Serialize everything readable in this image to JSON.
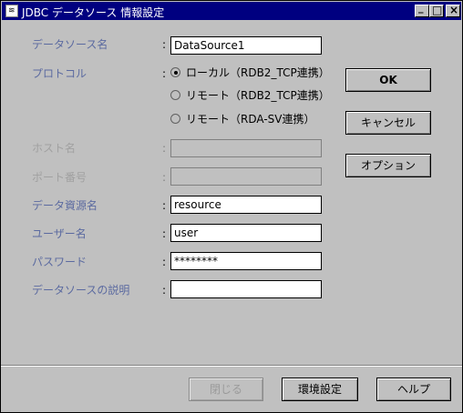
{
  "window": {
    "title": "JDBC データソース 情報設定",
    "icon_text": "≋",
    "minimize_glyph": "_",
    "maximize_glyph": "□",
    "close_glyph": "×"
  },
  "form": {
    "datasource_name": {
      "label": "データソース名",
      "value": "DataSource1"
    },
    "protocol": {
      "label": "プロトコル",
      "options": [
        {
          "label": "ローカル（RDB2_TCP連携）",
          "selected": true
        },
        {
          "label": "リモート（RDB2_TCP連携）",
          "selected": false
        },
        {
          "label": "リモート（RDA-SV連携）",
          "selected": false
        }
      ]
    },
    "host_name": {
      "label": "ホスト名",
      "value": ""
    },
    "port_number": {
      "label": "ポート番号",
      "value": ""
    },
    "data_resource_name": {
      "label": "データ資源名",
      "value": "resource"
    },
    "user_name": {
      "label": "ユーザー名",
      "value": "user"
    },
    "password": {
      "label": "パスワード",
      "value": "********"
    },
    "description": {
      "label": "データソースの説明",
      "value": ""
    },
    "colon": ":"
  },
  "side_buttons": {
    "ok": "OK",
    "cancel": "キャンセル",
    "options": "オプション"
  },
  "footer_buttons": {
    "close": "閉じる",
    "environment": "環境設定",
    "help": "ヘルプ"
  }
}
